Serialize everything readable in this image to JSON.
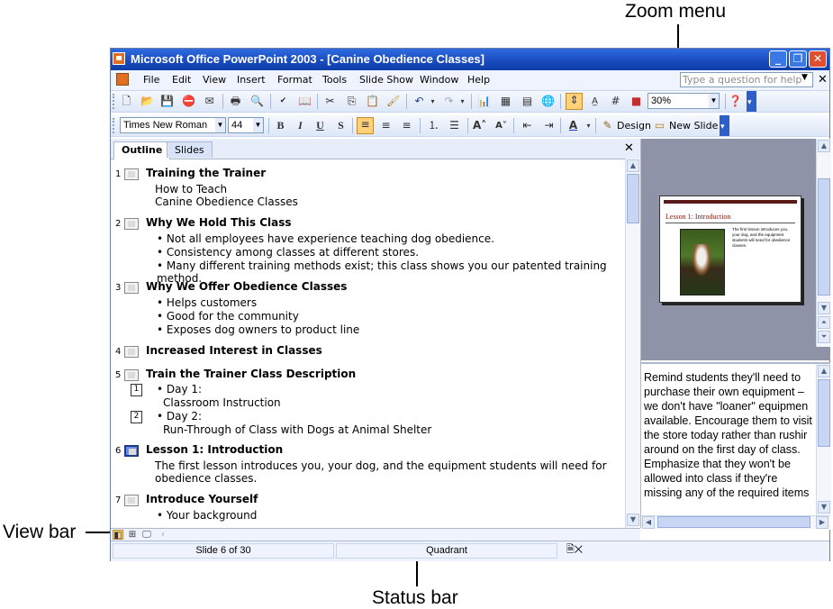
{
  "annotations": {
    "zoom_menu": "Zoom menu",
    "view_bar": "View bar",
    "status_bar": "Status bar"
  },
  "window": {
    "title": "Microsoft Office PowerPoint 2003 - [Canine Obedience Classes]"
  },
  "menubar": {
    "items": [
      "File",
      "Edit",
      "View",
      "Insert",
      "Format",
      "Tools",
      "Slide Show",
      "Window",
      "Help"
    ],
    "help_placeholder": "Type a question for help"
  },
  "standard_toolbar": {
    "zoom_value": "30%"
  },
  "formatting_toolbar": {
    "font": "Times New Roman",
    "font_size": "44",
    "bold": "B",
    "italic": "I",
    "underline": "U",
    "shadow": "S",
    "design_label": "Design",
    "new_slide_label": "New Slide"
  },
  "outline_pane": {
    "tabs": [
      "Outline",
      "Slides"
    ],
    "slides": [
      {
        "num": "1",
        "title": "Training the Trainer",
        "subs": [
          "How to Teach",
          "Canine Obedience Classes"
        ]
      },
      {
        "num": "2",
        "title": "Why We Hold This Class",
        "bullets": [
          "Not all employees have experience teaching dog obedience.",
          "Consistency among classes at different stores.",
          "Many different training methods exist; this class shows you our patented training method."
        ]
      },
      {
        "num": "3",
        "title": "Why We Offer Obedience Classes",
        "bullets": [
          "Helps customers",
          "Good for the community",
          "Exposes dog owners to product line"
        ]
      },
      {
        "num": "4",
        "title": "Increased Interest in Classes"
      },
      {
        "num": "5",
        "title": "Train the Trainer Class Description",
        "items": [
          {
            "anim": "1",
            "bullet": "Day 1:",
            "cont": "Classroom Instruction"
          },
          {
            "anim": "2",
            "bullet": "Day 2:",
            "cont": "Run-Through of Class with Dogs at Animal Shelter"
          }
        ]
      },
      {
        "num": "6",
        "title": "Lesson 1: Introduction",
        "subs": [
          "The first lesson introduces you, your dog, and the equipment students will need for",
          "obedience classes."
        ]
      },
      {
        "num": "7",
        "title": "Introduce Yourself",
        "bullets": [
          "Your background"
        ]
      }
    ]
  },
  "slide_preview": {
    "title": "Lesson 1: Introduction",
    "body": "The first lesson introduces you, your dog, and the equipment students will need for obedience classes."
  },
  "notes": {
    "text": "Remind students they'll need to\npurchase their own equipment –\nwe don't have \"loaner\" equipmen\navailable. Encourage them to visit\nthe store today rather than rushir\naround on the first day of class.\nEmphasize that they won't be\nallowed into class if they're\nmissing any of the required items"
  },
  "statusbar": {
    "slide_position": "Slide 6 of 30",
    "design_template": "Quadrant"
  },
  "icons": {
    "app": "powerpoint-icon",
    "spelling_status": "spelling-check-icon"
  }
}
